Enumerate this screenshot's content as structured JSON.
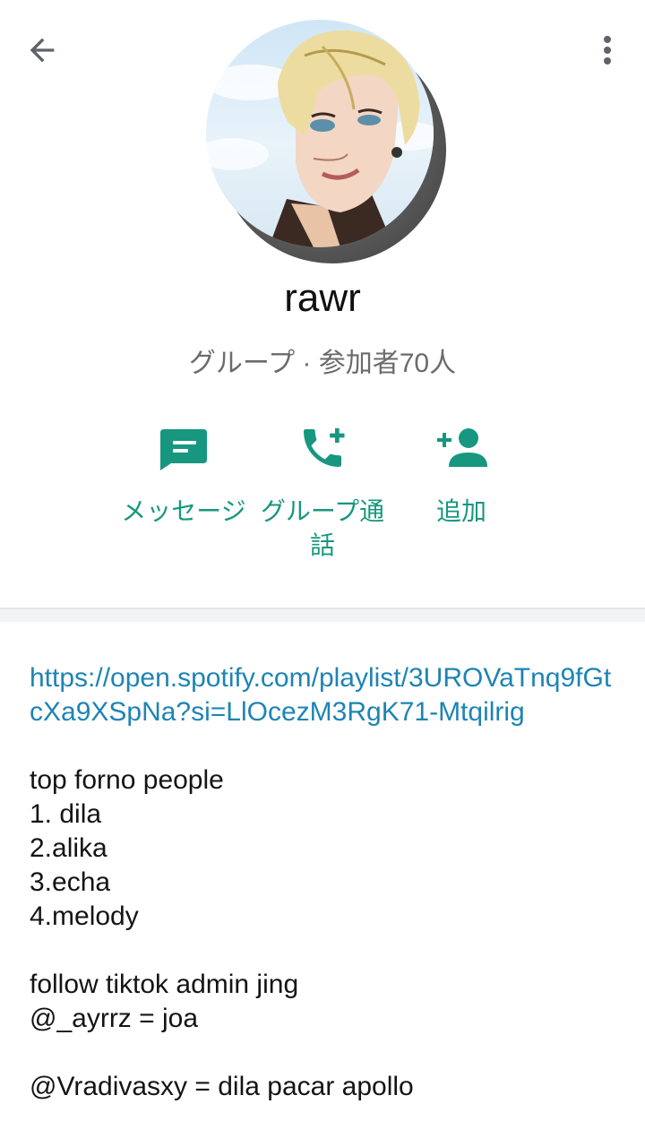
{
  "group": {
    "name": "rawr",
    "subtitle": "グループ · 参加者70人"
  },
  "actions": [
    {
      "label": "メッセージ",
      "icon": "message-icon"
    },
    {
      "label": "グループ通話",
      "icon": "add-call-icon"
    },
    {
      "label": "追加",
      "icon": "add-person-icon"
    }
  ],
  "description": {
    "link": "https://open.spotify.com/playlist/3UROVaTnq9fGtcXa9XSpNa?si=LlOcezM3RgK71-Mtqilrig",
    "lines": [
      "top forno people",
      "1. dila",
      "2.alika",
      "3.echa",
      "4.melody",
      "",
      "follow tiktok admin jing",
      "@_ayrrz = joa",
      "",
      "@Vradivasxy = dila pacar apollo"
    ]
  },
  "colors": {
    "accent": "#17977f",
    "link": "#1e84b4",
    "subtitle": "#6b6b6b"
  }
}
